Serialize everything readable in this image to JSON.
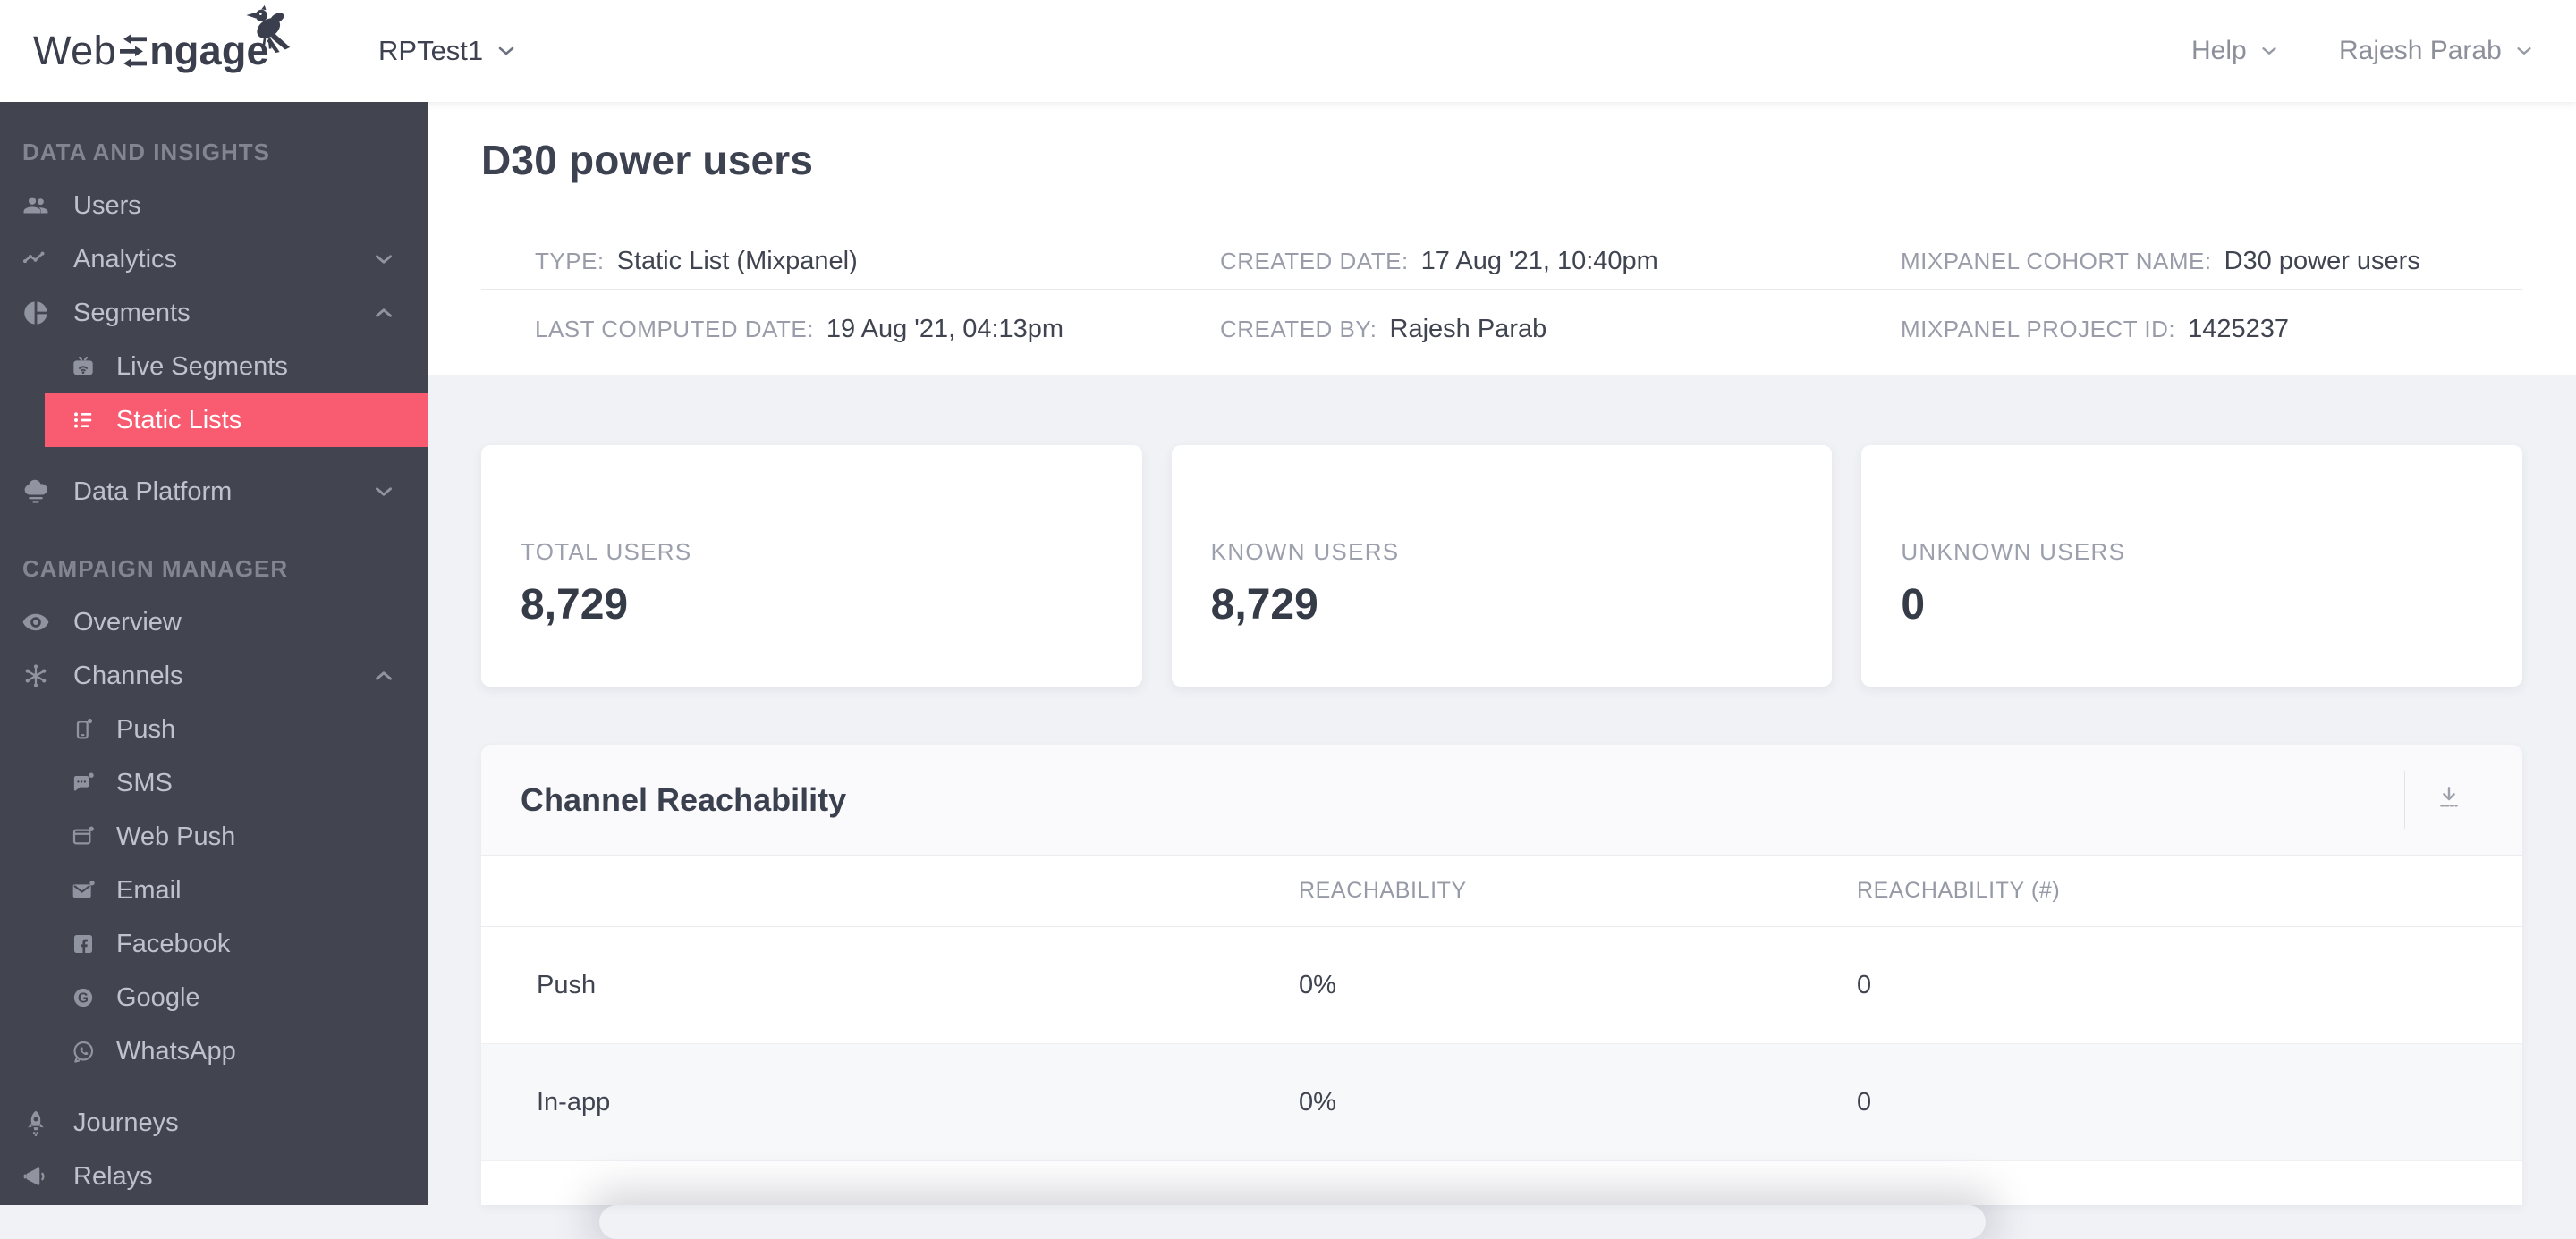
{
  "topbar": {
    "logo": {
      "web": "Web",
      "ngage": "ngage",
      "arrow_e_icon": "arrow-e-icon",
      "bird_icon": "bird-icon"
    },
    "project_selector": "RPTest1",
    "project_chevron_icon": "chevron-down-icon",
    "help_label": "Help",
    "user_name": "Rajesh Parab"
  },
  "sidebar": {
    "sections": [
      {
        "header": "DATA AND INSIGHTS",
        "items": [
          {
            "label": "Users",
            "icon": "users-icon"
          },
          {
            "label": "Analytics",
            "icon": "analytics-icon",
            "chevron": "down"
          },
          {
            "label": "Segments",
            "icon": "segments-icon",
            "chevron": "up"
          },
          {
            "label": "Live Segments",
            "icon": "live-segments-icon",
            "sub": true
          },
          {
            "label": "Static Lists",
            "icon": "static-lists-icon",
            "sub": true,
            "active": true
          },
          {
            "label": "Data Platform",
            "icon": "data-platform-icon",
            "chevron": "down"
          }
        ]
      },
      {
        "header": "CAMPAIGN MANAGER",
        "items": [
          {
            "label": "Overview",
            "icon": "overview-icon"
          },
          {
            "label": "Channels",
            "icon": "channels-icon",
            "chevron": "up"
          },
          {
            "label": "Push",
            "icon": "push-icon",
            "sub": true
          },
          {
            "label": "SMS",
            "icon": "sms-icon",
            "sub": true
          },
          {
            "label": "Web Push",
            "icon": "web-push-icon",
            "sub": true
          },
          {
            "label": "Email",
            "icon": "email-icon",
            "sub": true
          },
          {
            "label": "Facebook",
            "icon": "facebook-icon",
            "sub": true
          },
          {
            "label": "Google",
            "icon": "google-icon",
            "sub": true
          },
          {
            "label": "WhatsApp",
            "icon": "whatsapp-icon",
            "sub": true
          },
          {
            "label": "Journeys",
            "icon": "journeys-icon"
          },
          {
            "label": "Relays",
            "icon": "relays-icon"
          }
        ]
      }
    ]
  },
  "page": {
    "title": "D30 power users",
    "meta": {
      "row1": [
        {
          "label": "TYPE:",
          "value": "Static List (Mixpanel)"
        },
        {
          "label": "CREATED DATE:",
          "value": "17 Aug '21, 10:40pm"
        },
        {
          "label": "MIXPANEL COHORT NAME:",
          "value": "D30 power users"
        }
      ],
      "row2": [
        {
          "label": "LAST COMPUTED DATE:",
          "value": "19 Aug '21, 04:13pm"
        },
        {
          "label": "CREATED BY:",
          "value": "Rajesh Parab"
        },
        {
          "label": "MIXPANEL PROJECT ID:",
          "value": "1425237"
        }
      ]
    },
    "stat_cards": [
      {
        "label": "TOTAL USERS",
        "value": "8,729"
      },
      {
        "label": "KNOWN USERS",
        "value": "8,729"
      },
      {
        "label": "UNKNOWN USERS",
        "value": "0"
      }
    ],
    "reachability": {
      "title": "Channel Reachability",
      "download_icon": "download-icon",
      "columns": [
        "REACHABILITY",
        "REACHABILITY (#)"
      ],
      "rows": [
        {
          "channel": "Push",
          "reachability": "0%",
          "reachability_count": "0"
        },
        {
          "channel": "In-app",
          "reachability": "0%",
          "reachability_count": "0"
        }
      ]
    }
  },
  "colors": {
    "accent": "#f95c70",
    "sidebar_bg": "#42444f",
    "page_bg": "#f1f2f6",
    "topbar_bg": "#ffffff",
    "text_dark": "#3d4251",
    "text_muted": "#9a9da9"
  }
}
